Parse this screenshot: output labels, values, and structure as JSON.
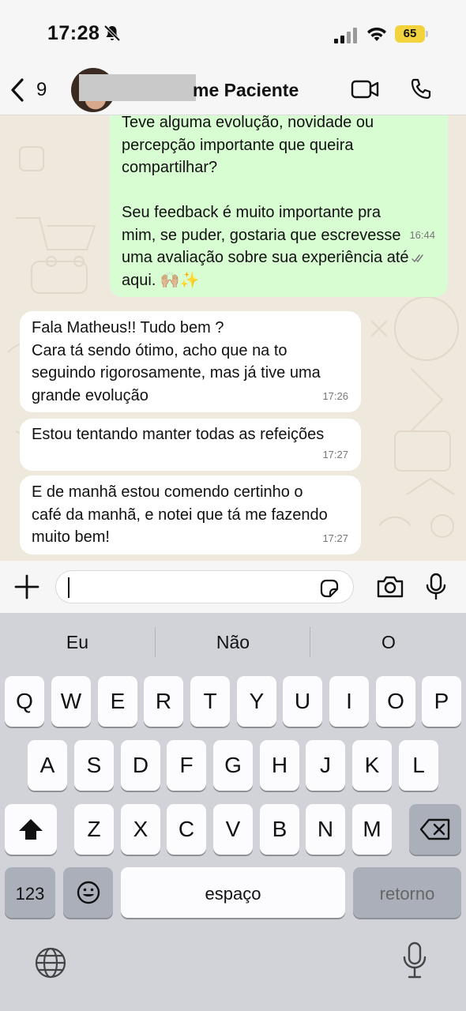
{
  "status_bar": {
    "time": "17:28",
    "battery": "65",
    "icons": [
      "bell-slash-icon",
      "signal-icon",
      "wifi-icon",
      "battery-icon"
    ]
  },
  "header": {
    "back_count": "9",
    "contact_name": "me Paciente",
    "icons": [
      "chevron-left-icon",
      "video-icon",
      "phone-icon"
    ]
  },
  "messages": [
    {
      "direction": "outgoing",
      "text": "Teve alguma evolução, novidade ou\npercepção importante que queira\ncompartilhar?\n\nSeu feedback é muito importante pra\nmim, se puder, gostaria que escrevesse\numa avaliação sobre sua experiência até\naqui. 🙌🏼✨",
      "time": "16:44",
      "status": "read"
    },
    {
      "direction": "incoming",
      "text": "Fala Matheus!! Tudo bem ?\nCara tá sendo ótimo, acho que na to\nseguindo rigorosamente, mas já tive uma\ngrande evolução",
      "time": "17:26"
    },
    {
      "direction": "incoming",
      "text": "Estou tentando manter todas as refeições",
      "time": "17:27"
    },
    {
      "direction": "incoming",
      "text": "E de manhã estou comendo certinho o\ncafé da manhã, e notei que tá me fazendo\nmuito bem!",
      "time": "17:27"
    }
  ],
  "input": {
    "value": "",
    "icons": [
      "plus-icon",
      "sticker-icon",
      "camera-icon",
      "microphone-icon"
    ]
  },
  "keyboard": {
    "suggestions": [
      "Eu",
      "Não",
      "O"
    ],
    "row1": [
      "Q",
      "W",
      "E",
      "R",
      "T",
      "Y",
      "U",
      "I",
      "O",
      "P"
    ],
    "row2": [
      "A",
      "S",
      "D",
      "F",
      "G",
      "H",
      "J",
      "K",
      "L"
    ],
    "row3": [
      "Z",
      "X",
      "C",
      "V",
      "B",
      "N",
      "M"
    ],
    "numbers_label": "123",
    "space_label": "espaço",
    "return_label": "retorno",
    "icons": [
      "shift-icon",
      "delete-icon",
      "emoji-icon",
      "globe-icon",
      "dictation-icon"
    ]
  },
  "colors": {
    "outgoing_bubble": "#d8fdd2",
    "incoming_bubble": "#ffffff",
    "keyboard_bg": "#d1d3d9",
    "battery": "#f2d33e"
  }
}
